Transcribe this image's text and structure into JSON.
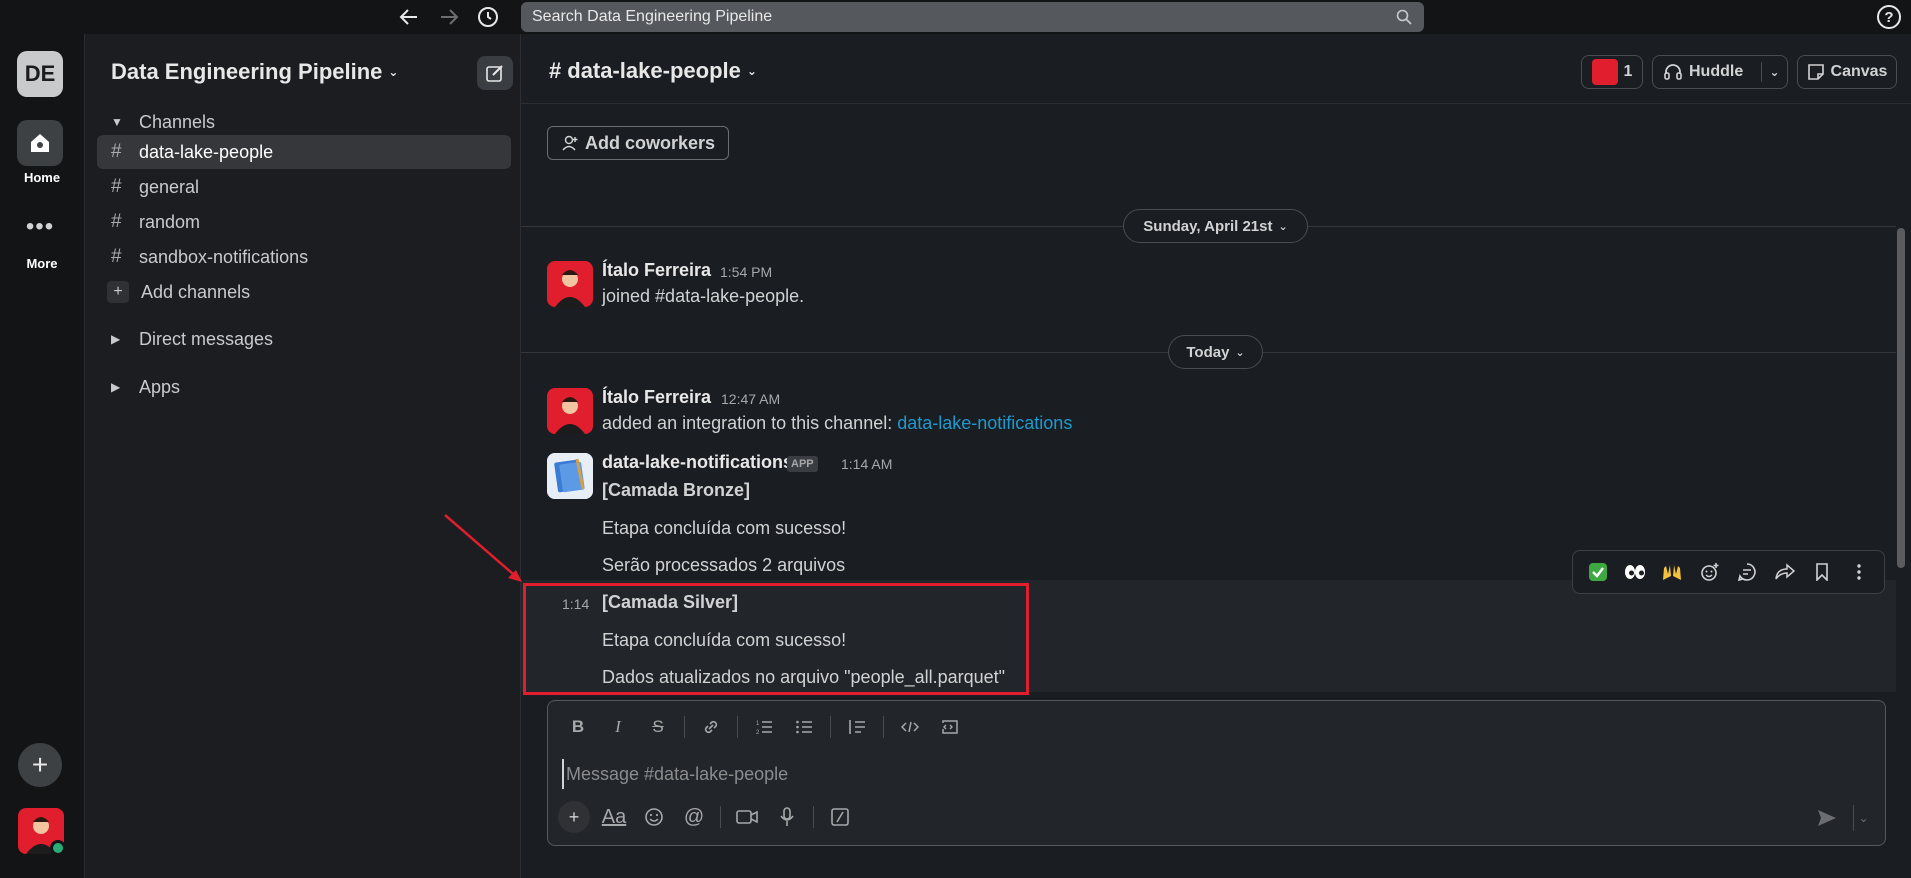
{
  "search": {
    "placeholder": "Search Data Engineering Pipeline"
  },
  "rail": {
    "workspace_initials": "DE",
    "home_label": "Home",
    "more_label": "More"
  },
  "sidebar": {
    "workspace_name": "Data Engineering Pipeline",
    "channels_header": "Channels",
    "channels": [
      "data-lake-people",
      "general",
      "random",
      "sandbox-notifications"
    ],
    "add_channels": "Add channels",
    "direct_messages": "Direct messages",
    "apps": "Apps"
  },
  "channel": {
    "name": "data-lake-people",
    "member_count": "1",
    "huddle_label": "Huddle",
    "canvas_label": "Canvas",
    "add_coworkers": "Add coworkers"
  },
  "dates": {
    "first": "Sunday, April 21st",
    "second": "Today"
  },
  "messages": [
    {
      "author": "Ítalo Ferreira",
      "time": "1:54 PM",
      "text": "joined #data-lake-people."
    },
    {
      "author": "Ítalo Ferreira",
      "time": "12:47 AM",
      "text": "added an integration to this channel: ",
      "link": "data-lake-notifications"
    },
    {
      "author": "data-lake-notifications",
      "badge": "APP",
      "time": "1:14 AM",
      "lines": [
        "[Camada Bronze]",
        "Etapa concluída com sucesso!",
        "Serão processados 2 arquivos"
      ]
    },
    {
      "time": "1:14",
      "lines": [
        "[Camada Silver]",
        "Etapa concluída com sucesso!",
        "Dados atualizados no arquivo \"people_all.parquet\""
      ]
    }
  ],
  "composer": {
    "placeholder": "Message #data-lake-people"
  },
  "colors": {
    "highlight": "#e01e2d",
    "link": "#1d9bd1",
    "avatar": "#e01e2d"
  }
}
